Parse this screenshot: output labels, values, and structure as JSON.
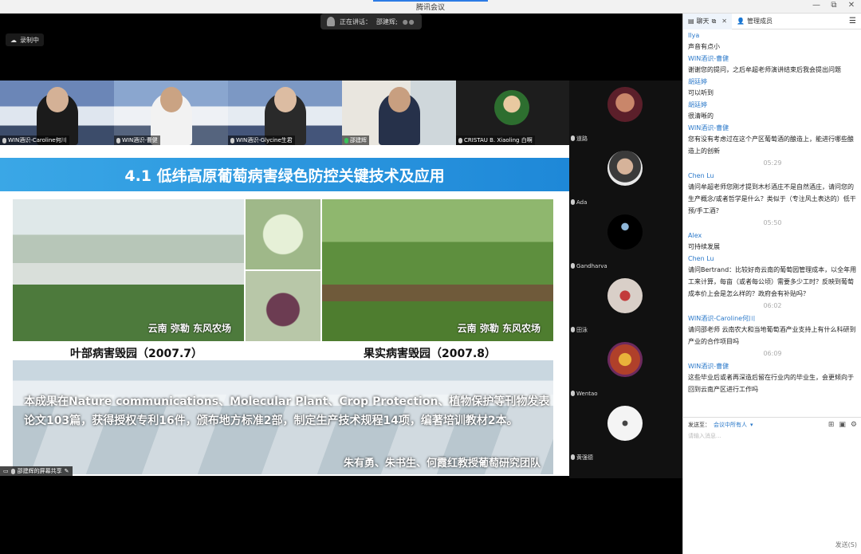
{
  "app": {
    "title": "腾讯会议",
    "window_controls": [
      "—",
      "⧉",
      "✕"
    ]
  },
  "recording": {
    "label": "录制中"
  },
  "speaking": {
    "label": "正在讲话：",
    "name": "邵建辉;"
  },
  "thumbnails": [
    {
      "name": "WIN酒识-Caroline何川"
    },
    {
      "name": "WIN酒识-曹健"
    },
    {
      "name": "WIN酒识-Glycine生君"
    },
    {
      "name": "邵建辉"
    },
    {
      "name": "CRISTAU B. Xiaoling 白啊"
    }
  ],
  "gallery": [
    {
      "name": "道路"
    },
    {
      "name": "Ada"
    },
    {
      "name": "Gandharva"
    },
    {
      "name": "田泳"
    },
    {
      "name": "Wentao"
    },
    {
      "name": "黄强德"
    }
  ],
  "slide": {
    "title": "4.1 低纬高原葡萄病害绿色防控关键技术及应用",
    "caption_left": "云南 弥勒 东风农场",
    "caption_right": "云南 弥勒 东风农场",
    "sub_left": "叶部病害毁园（2007.7）",
    "sub_right": "果实病害毁园（2007.8）",
    "body": "本成果在Nature communications、Molecular Plant、Crop Protection、植物保护等刊物发表论文103篇，获得授权专利16件，颁布地方标准2部，制定生产技术规程14项，编著培训教材2本。",
    "team": "朱有勇、朱书生、何霞红教授葡萄研究团队"
  },
  "share_bar": {
    "label": "邵建辉的屏幕共享"
  },
  "chat": {
    "tab_chat": "聊天",
    "tab_members": "管理成员",
    "messages": [
      {
        "sender": "Ilya",
        "text": "声音有点小"
      },
      {
        "sender": "WIN酒识-曹健",
        "text": "谢谢您的提问，之后牟超老师演讲结束后我会提出问题"
      },
      {
        "sender": "胡廷婷",
        "text": "可以听到"
      },
      {
        "sender": "胡廷婷",
        "text": "很清晰的"
      },
      {
        "sender": "WIN酒识-曹健",
        "text": "您有没有考虑过在这个产区葡萄酒的酿造上，能进行哪些酿造上的创新"
      },
      {
        "time": "05:29"
      },
      {
        "sender": "Chen Lu",
        "text": "请问牟超老师您刚才提到木杉酒庄不是自然酒庄，请问您的生产概念/或者哲学是什么？类似于（专注风土表达的）低干预/手工酒？"
      },
      {
        "time": "05:50"
      },
      {
        "sender": "Alex",
        "text": "可持续发展"
      },
      {
        "sender": "Chen Lu",
        "text": "请问Bertrand：比较好奇云南的葡萄园管理成本，以全年用工来计算，每亩（或者每公顷）需要多少工时？反映到葡萄成本价上会是怎么样的？政府会有补贴吗？"
      },
      {
        "time": "06:02"
      },
      {
        "sender": "WIN酒识-Caroline何川",
        "text": "请问邵老师 云南农大和当地葡萄酒产业支持上有什么科研到产业的合作项目吗"
      },
      {
        "time": "06:09"
      },
      {
        "sender": "WIN酒识-曹健",
        "text": "这些毕业后或者再深造后留在行业内的毕业生，会更倾向于回到云南产区进行工作吗"
      }
    ],
    "send_to_label": "发送至：",
    "send_to_target": "会议中所有人",
    "input_placeholder": "请输入消息...",
    "send_button": "发送(S)"
  }
}
